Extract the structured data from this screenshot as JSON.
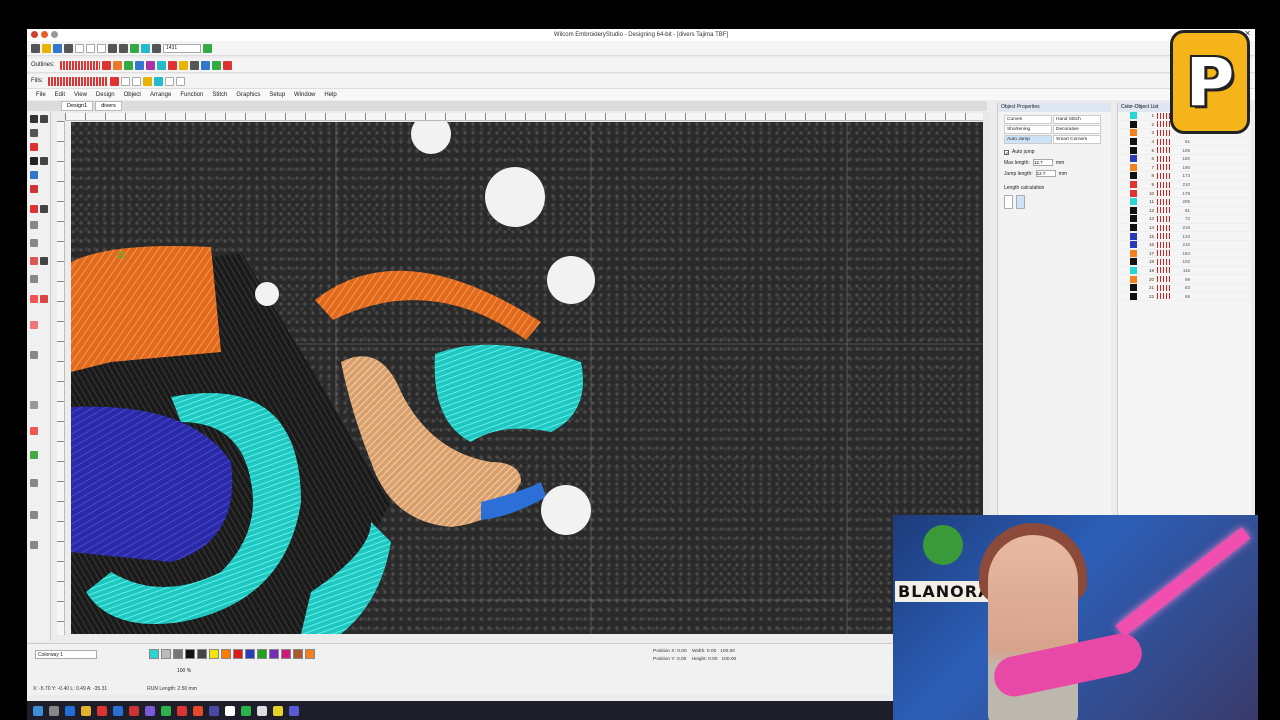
{
  "window": {
    "title": "Wilcom EmbroideryStudio - Designing 64-bit - [divers     Tajima TBF]"
  },
  "toolbars": {
    "outlines_label": "Outlines:",
    "fills_label": "Fills:",
    "zoom_value": "1431"
  },
  "menu": [
    "File",
    "Edit",
    "View",
    "Design",
    "Object",
    "Arrange",
    "Function",
    "Stitch",
    "Graphics",
    "Setup",
    "Window",
    "Help"
  ],
  "doc_tabs": [
    "Design1",
    "divers"
  ],
  "object_properties": {
    "title": "Object Properties",
    "tabs": [
      "Curves",
      "Hand Stitch",
      "Shortening",
      "Decorative",
      "Auto Jump",
      "Smart Corners"
    ],
    "auto_jump_label": "Auto jump",
    "max_length_label": "Max length:",
    "max_length_value": "12.7",
    "jump_length_label": "Jump length:",
    "jump_length_value": "12.7",
    "unit": "mm",
    "length_calc_label": "Length calculation"
  },
  "color_object_list": {
    "title": "Color-Object List",
    "rows": [
      {
        "n": "1",
        "c": ""
      },
      {
        "n": "2",
        "c": "651"
      },
      {
        "n": "3",
        "c": "90"
      },
      {
        "n": "4",
        "c": "61"
      },
      {
        "n": "5",
        "c": "105"
      },
      {
        "n": "6",
        "c": "180"
      },
      {
        "n": "7",
        "c": "190"
      },
      {
        "n": "8",
        "c": "173"
      },
      {
        "n": "9",
        "c": "210"
      },
      {
        "n": "10",
        "c": "179"
      },
      {
        "n": "11",
        "c": "205"
      },
      {
        "n": "12",
        "c": "81"
      },
      {
        "n": "13",
        "c": "72"
      },
      {
        "n": "14",
        "c": "218"
      },
      {
        "n": "15",
        "c": "133"
      },
      {
        "n": "16",
        "c": "216"
      },
      {
        "n": "17",
        "c": "184"
      },
      {
        "n": "18",
        "c": "102"
      },
      {
        "n": "19",
        "c": "115"
      },
      {
        "n": "20",
        "c": "99"
      },
      {
        "n": "21",
        "c": "83"
      },
      {
        "n": "22",
        "c": "68"
      }
    ]
  },
  "bottom": {
    "colorway": "Colorway 1",
    "position_x_label": "Position X:",
    "position_x": "0.00",
    "position_y_label": "Position Y:",
    "position_y": "0.00",
    "width_label": "Width:",
    "width": "0.00",
    "height_label": "Height:",
    "height": "0.00",
    "scale_w": "100.00",
    "scale_h": "100.00",
    "run_length_label": "RUN Length: 2.50 mm",
    "coords": "X:  -5.70 Y:  -0.40 L:  0.49 A:  -35.31",
    "pct": "100 %"
  },
  "palette_colors": [
    "#2bd6d2",
    "#bbbbbb",
    "#777777",
    "#111111",
    "#444444",
    "#f2e600",
    "#ff7b00",
    "#d81c1c",
    "#2a3ab8",
    "#1fa31f",
    "#7a2ab8",
    "#cc1a7a",
    "#a85a2a",
    "#f58020"
  ],
  "webcam": {
    "sign": "BLANORA"
  },
  "logo": {
    "letter": "P"
  }
}
